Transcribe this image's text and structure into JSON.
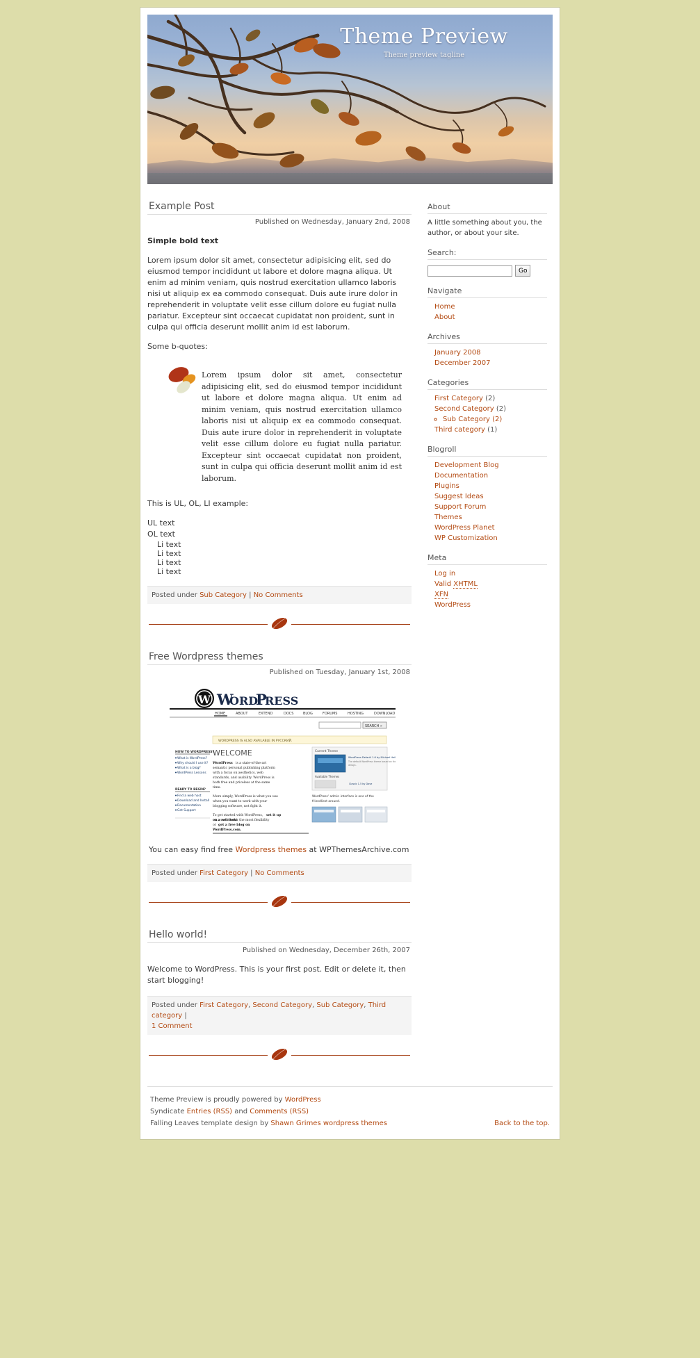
{
  "header": {
    "title": "Theme Preview",
    "tagline": "Theme preview tagline"
  },
  "posts": [
    {
      "title": "Example Post",
      "date": "Published on Wednesday, January 2nd, 2008",
      "bold_line": "Simple bold text",
      "paragraph": "Lorem ipsum dolor sit amet, consectetur adipisicing elit, sed do eiusmod tempor incididunt ut labore et dolore magna aliqua. Ut enim ad minim veniam, quis nostrud exercitation ullamco laboris nisi ut aliquip ex ea commodo consequat. Duis aute irure dolor in reprehenderit in voluptate velit esse cillum dolore eu fugiat nulla pariatur. Excepteur sint occaecat cupidatat non proident, sunt in culpa qui officia deserunt mollit anim id est laborum.",
      "quote_intro": "Some b-quotes:",
      "blockquote": "Lorem ipsum dolor sit amet, consectetur adipisicing elit, sed do eiusmod tempor incididunt ut labore et dolore magna aliqua. Ut enim ad minim veniam, quis nostrud exercitation ullamco laboris nisi ut aliquip ex ea commodo consequat. Duis aute irure dolor in reprehenderit in voluptate velit esse cillum dolore eu fugiat nulla pariatur. Excepteur sint occaecat cupidatat non proident, sunt in culpa qui officia deserunt mollit anim id est laborum.",
      "list_intro": "This is UL, OL, LI example:",
      "ul_item": "UL text",
      "ol_item": "OL text",
      "li_items": [
        "Li text",
        "Li text",
        "Li text",
        "Li text"
      ],
      "footer_prefix": "Posted under ",
      "footer_category": "Sub Category",
      "footer_sep": " | ",
      "footer_comments": "No Comments"
    },
    {
      "title": "Free Wordpress themes",
      "date": "Published on Tuesday, January 1st, 2008",
      "caption_pre": "You can easy find free ",
      "caption_link": "Wordpress themes",
      "caption_post": " at WPThemesArchive.com",
      "footer_prefix": "Posted under ",
      "footer_category": "First Category",
      "footer_sep": " | ",
      "footer_comments": "No Comments"
    },
    {
      "title": "Hello world!",
      "date": "Published on Wednesday, December 26th, 2007",
      "paragraph": "Welcome to WordPress. This is your first post. Edit or delete it, then start blogging!",
      "footer_prefix": "Posted under ",
      "footer_categories": [
        "First Category",
        "Second Category",
        "Sub Category",
        "Third category"
      ],
      "footer_sep": " | ",
      "footer_comments": "1 Comment"
    }
  ],
  "screenshot": {
    "logo_text": "WordPress",
    "nav": [
      "HOME",
      "ABOUT",
      "EXTEND",
      "DOCS",
      "BLOG",
      "FORUMS",
      "HOSTING",
      "DOWNLOAD"
    ],
    "search_button": "SEARCH »",
    "notice": "WORDPRESS IS ALSO AVAILABLE IN РУССКИЙ.",
    "welcome_heading": "WELCOME",
    "sidebar_heading_1": "HOW TO WORDPRESS?",
    "sidebar_links_1": [
      "What is WordPress?",
      "Why should I use it?",
      "What is a blog?",
      "WordPress Lessons"
    ],
    "sidebar_heading_2": "READY TO BEGIN?",
    "sidebar_links_2": [
      "Find a web host",
      "Download and Install",
      "Documentation",
      "Get Support"
    ],
    "body_1_lead": "WordPress",
    "body_1": "is a state-of-the-art semantic personal publishing platform with a focus on aesthetics, web standards, and usability. WordPress is both free and priceless at the same time.",
    "body_2": "More simply, WordPress is what you use when you want to work with your blogging software, not fight it.",
    "body_3_pre": "To get started with WordPress, ",
    "body_3_b1": "set it up on a web host",
    "body_3_mid": " for the most flexibility or ",
    "body_3_b2": "get a free blog on WordPress.com",
    "panel_title": "Current Theme",
    "panel_sub": "WordPress Default 1.6 by Michael Heilemann",
    "panel_available": "Available Themes",
    "caption": "WordPress' admin interface is one of the friendliest around."
  },
  "sidebar": {
    "widgets": [
      {
        "name": "about",
        "title": "About",
        "text": "A little something about you, the author, or about your site."
      },
      {
        "name": "search",
        "title": "Search:",
        "input_value": "",
        "input_placeholder": "",
        "button_label": "Go"
      },
      {
        "name": "navigate",
        "title": "Navigate",
        "items": [
          {
            "label": "Home"
          },
          {
            "label": "About"
          }
        ]
      },
      {
        "name": "archives",
        "title": "Archives",
        "items": [
          {
            "label": "January 2008"
          },
          {
            "label": "December 2007"
          }
        ]
      },
      {
        "name": "categories",
        "title": "Categories",
        "items": [
          {
            "label": "First Category",
            "count": "(2)"
          },
          {
            "label": "Second Category",
            "count": "(2)",
            "children": [
              {
                "label": "Sub Category",
                "count": "(2)"
              }
            ]
          },
          {
            "label": "Third category",
            "count": "(1)"
          }
        ]
      },
      {
        "name": "blogroll",
        "title": "Blogroll",
        "items": [
          {
            "label": "Development Blog"
          },
          {
            "label": "Documentation"
          },
          {
            "label": "Plugins"
          },
          {
            "label": "Suggest Ideas"
          },
          {
            "label": "Support Forum"
          },
          {
            "label": "Themes"
          },
          {
            "label": "WordPress Planet"
          },
          {
            "label": "WP Customization"
          }
        ]
      },
      {
        "name": "meta",
        "title": "Meta",
        "items": [
          {
            "label": "Log in"
          },
          {
            "label": "Valid XHTML",
            "abbr": "XHTML",
            "prefix": "Valid "
          },
          {
            "label": "XFN",
            "abbr": "XFN",
            "prefix": ""
          },
          {
            "label": "WordPress"
          }
        ]
      }
    ]
  },
  "footer": {
    "line1_pre": "Theme Preview is proudly powered by ",
    "line1_link": "WordPress",
    "line2_pre": "Syndicate ",
    "line2_link1": "Entries (RSS)",
    "line2_mid": " and ",
    "line2_link2": "Comments (RSS)",
    "line3_pre": "Falling Leaves template design by ",
    "line3_link": "Shawn Grimes wordpress themes",
    "back_to_top": "Back to the top."
  },
  "colors": {
    "page_bg": "#ddddaa",
    "link": "#b34a12",
    "divider": "#a8451c",
    "heading": "#555555"
  }
}
